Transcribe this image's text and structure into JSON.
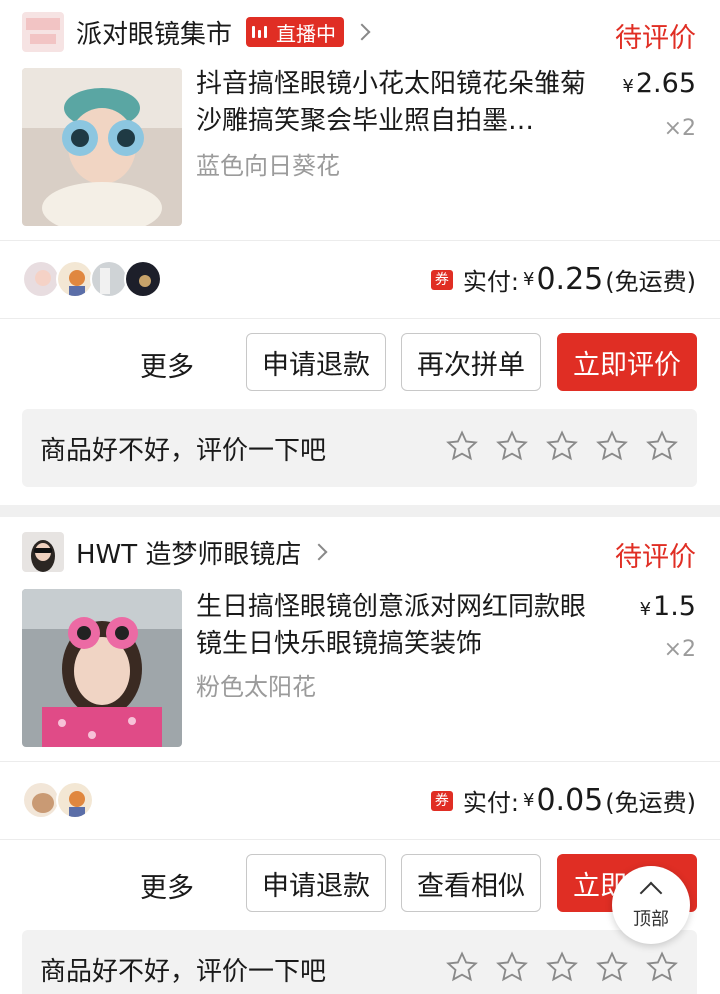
{
  "orders": [
    {
      "shop_name": "派对眼镜集市",
      "shop_avatar_text": "派对眼镜\n集市",
      "live_badge": "直播中",
      "status": "待评价",
      "product_title": "抖音搞怪眼镜小花太阳镜花朵雏菊沙雕搞笑聚会毕业照自拍墨…",
      "variant": "蓝色向日葵花",
      "price_symbol": "¥",
      "price": "2.65",
      "quantity": "×2",
      "coupon": "券",
      "paid_label": "实付:",
      "paid_symbol": "¥",
      "paid_amount": "0.25",
      "shipping_note": "(免运费)",
      "more": "更多",
      "btn_refund": "申请退款",
      "btn_second": "再次拼单",
      "btn_review": "立即评价",
      "review_prompt": "商品好不好，评价一下吧"
    },
    {
      "shop_name": "HWT 造梦师眼镜店",
      "status": "待评价",
      "product_title": "生日搞怪眼镜创意派对网红同款眼镜生日快乐眼镜搞笑装饰",
      "variant": "粉色太阳花",
      "price_symbol": "¥",
      "price": "1.5",
      "quantity": "×2",
      "coupon": "券",
      "paid_label": "实付:",
      "paid_symbol": "¥",
      "paid_amount": "0.05",
      "shipping_note": "(免运费)",
      "more": "更多",
      "btn_refund": "申请退款",
      "btn_second": "查看相似",
      "btn_review": "立即评价",
      "review_prompt": "商品好不好，评价一下吧"
    }
  ],
  "back_to_top": "顶部",
  "colors": {
    "accent": "#e02e24",
    "muted": "#9b9b9b",
    "bar": "#f2f2f2"
  }
}
